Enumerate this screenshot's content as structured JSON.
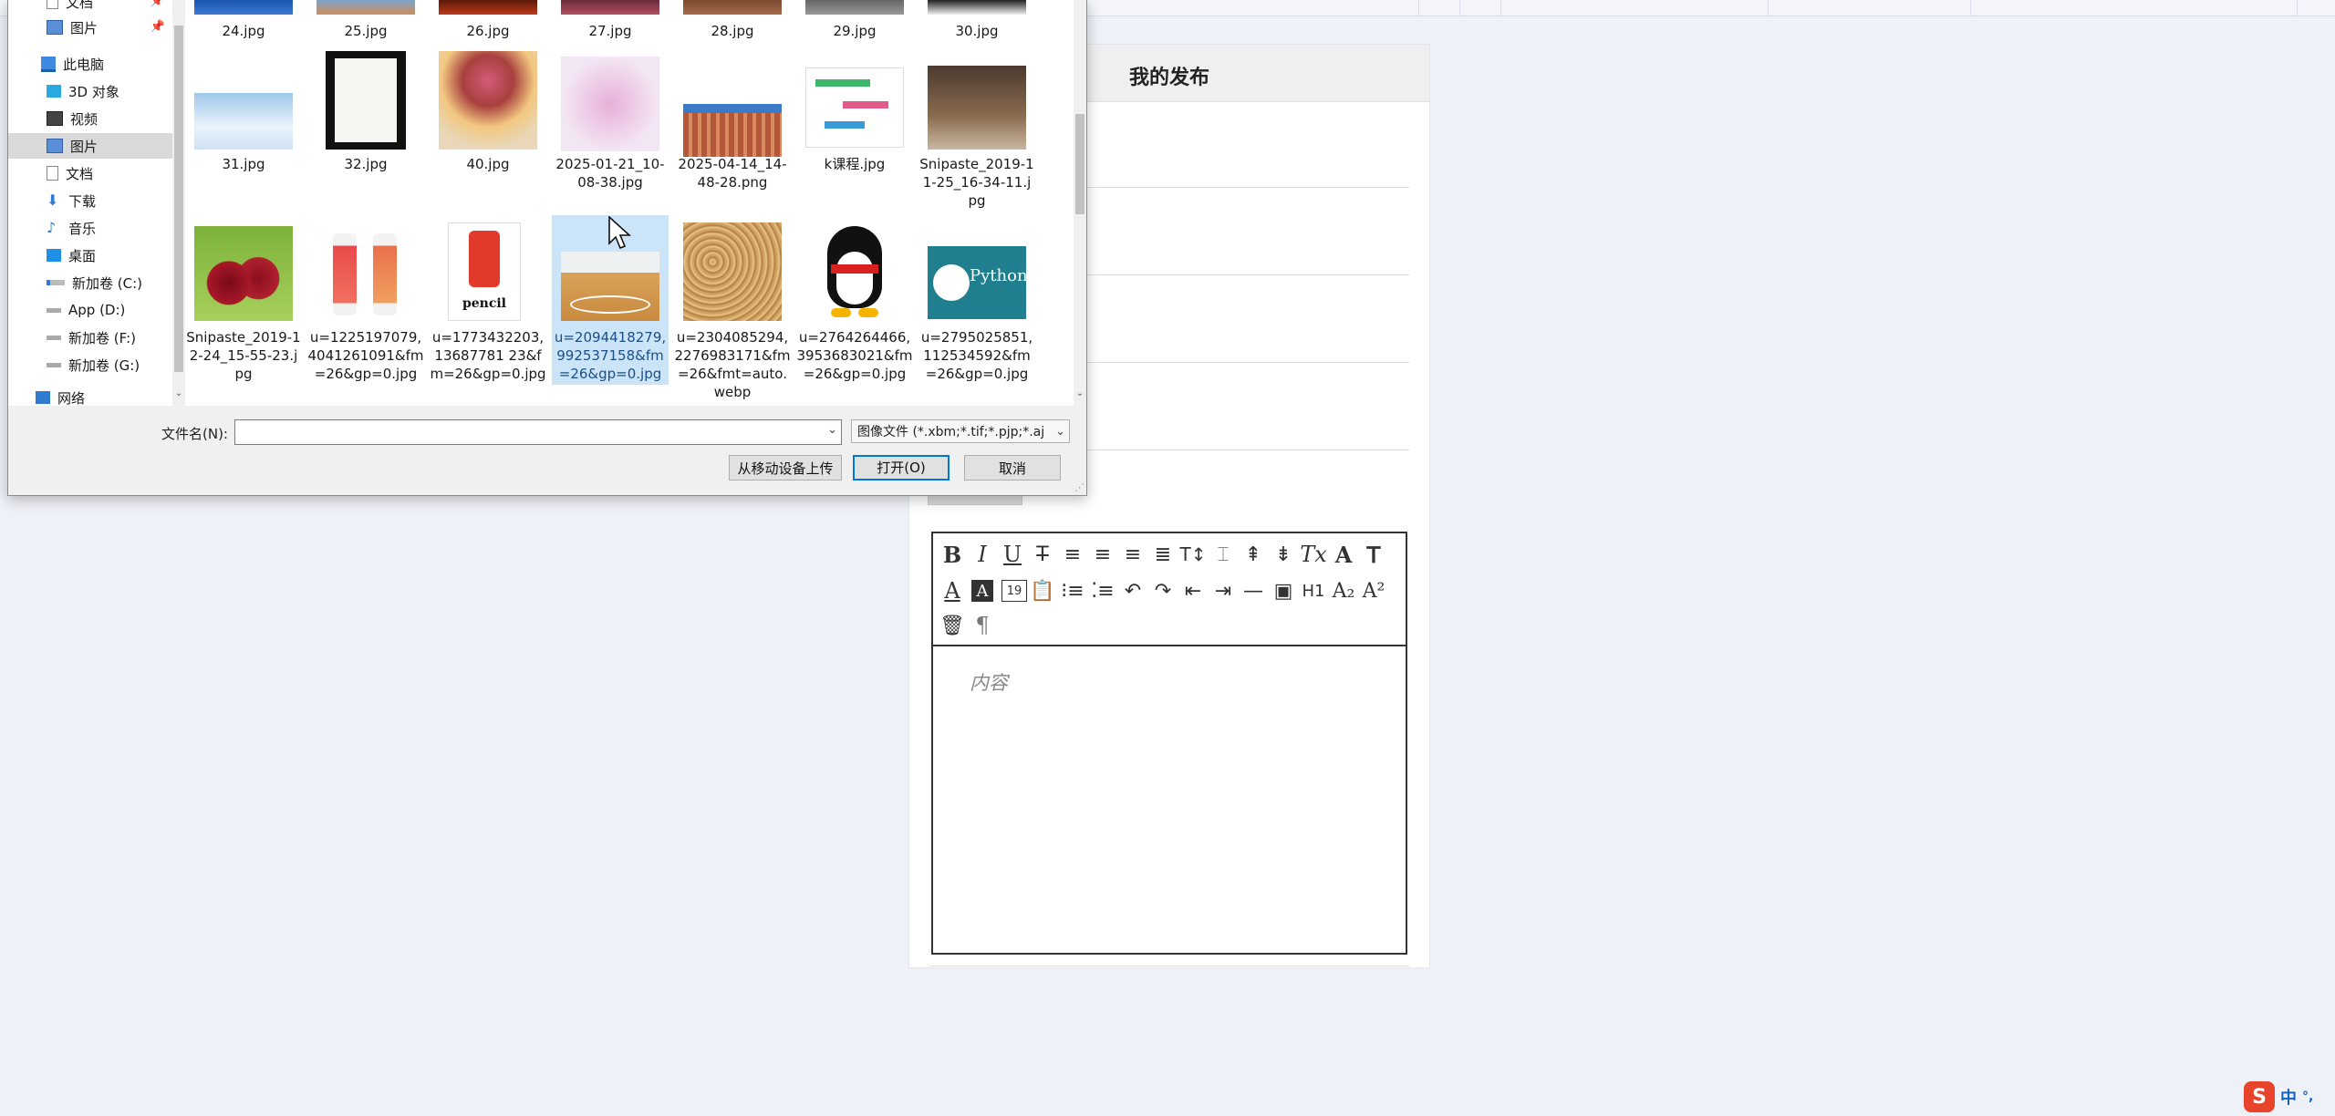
{
  "panel": {
    "title": "我的发布",
    "editor_placeholder": "内容"
  },
  "editor_toolbar": {
    "icons": [
      "bold-icon",
      "italic-icon",
      "underline-icon",
      "strikethrough-icon",
      "align-left-icon",
      "align-center-icon",
      "align-right-icon",
      "align-justify-icon",
      "text-size-icon",
      "line-height-icon",
      "indent-top-icon",
      "indent-bottom-icon",
      "clear-format-icon",
      "font-icon",
      "font-size-icon",
      "font-color-icon",
      "background-color-icon",
      "date-icon",
      "clipboard-icon",
      "ordered-list-icon",
      "unordered-list-icon",
      "undo-icon",
      "redo-icon",
      "outdent-icon",
      "indent-icon",
      "horizontal-rule-icon",
      "image-icon",
      "heading1-icon",
      "subscript-icon",
      "superscript-icon",
      "delete-icon",
      "paragraph-icon"
    ],
    "h1": "H1"
  },
  "dialog": {
    "nav": [
      {
        "label": "文档"
      },
      {
        "label": "图片"
      },
      {
        "label": "此电脑"
      },
      {
        "label": "3D 对象"
      },
      {
        "label": "视频"
      },
      {
        "label": "图片"
      },
      {
        "label": "文档"
      },
      {
        "label": "下载"
      },
      {
        "label": "音乐"
      },
      {
        "label": "桌面"
      },
      {
        "label": "新加卷 (C:)"
      },
      {
        "label": "App (D:)"
      },
      {
        "label": "新加卷 (F:)"
      },
      {
        "label": "新加卷 (G:)"
      },
      {
        "label": "网络"
      }
    ],
    "files_row1": [
      "24.jpg",
      "25.jpg",
      "26.jpg",
      "27.jpg",
      "28.jpg",
      "29.jpg",
      "30.jpg"
    ],
    "files_row2": [
      "31.jpg",
      "32.jpg",
      "40.jpg",
      "2025-01-21_10-08-38.jpg",
      "2025-04-14_14-48-28.png",
      "k课程.jpg",
      "Snipaste_2019-11-25_16-34-11.jpg"
    ],
    "files_row3": [
      "Snipaste_2019-12-24_15-55-23.jpg",
      "u=1225197079,4041261091&fm=26&gp=0.jpg",
      "u=1773432203,13687781 23&fm=26&gp=0.jpg",
      "u=2094418279,992537158&fm=26&gp=0.jpg",
      "u=2304085294,2276983171&fm=26&fmt=auto.webp",
      "u=2764264466,3953683021&fm=26&gp=0.jpg",
      "u=2795025851,112534592&fm=26&gp=0.jpg"
    ],
    "thumb_text": {
      "pencil": "pencil",
      "python": "Python"
    },
    "filename_label": "文件名(N):",
    "filename_value": "",
    "filter_value": "图像文件 (*.xbm;*.tif;*.pjp;*.aj",
    "btn_mobile": "从移动设备上传",
    "btn_open": "打开(O)",
    "btn_cancel": "取消"
  },
  "tray": {
    "ime_mode": "中",
    "ime_punct": "°,"
  }
}
